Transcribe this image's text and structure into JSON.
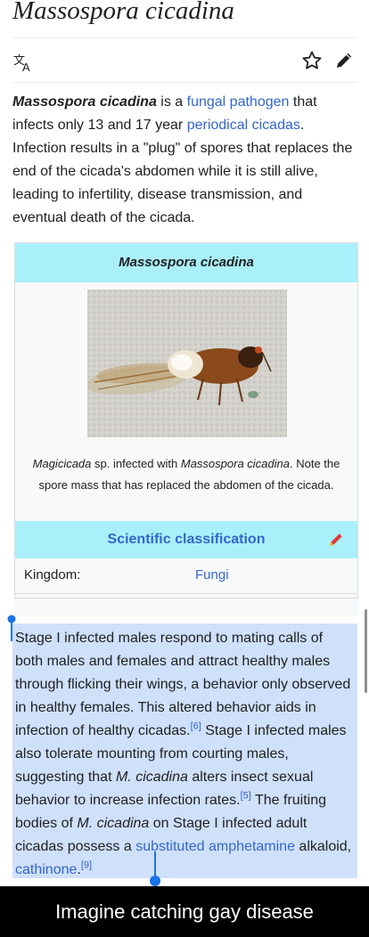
{
  "article": {
    "title": "Massospora cicadina",
    "intro": {
      "bold": "Massospora cicadina",
      "t1": " is a ",
      "link1": "fungal pathogen",
      "t2": " that infects only 13 and 17 year ",
      "link2": "periodical cicadas",
      "t3": ". Infection results in a \"plug\" of spores that replaces the end of the cicada's abdomen while it is still alive, leading to infertility, disease transmission, and eventual death of the cicada."
    }
  },
  "actions": {
    "translate_icon": "translate-icon",
    "watch_icon": "star-icon",
    "edit_icon": "pencil-icon"
  },
  "infobox": {
    "header": "Massospora cicadina",
    "caption": {
      "italic1": "Magicicada",
      "t1": " sp. infected with ",
      "italic2": "Massospora cicadina",
      "t2": ". Note the spore mass that has replaced the abdomen of the cicada."
    },
    "classification_header": "Scientific classification",
    "rows": [
      {
        "label": "Kingdom:",
        "value": "Fungi"
      }
    ]
  },
  "selection": {
    "t1": "Stage I infected males respond to mating calls of both males and females and attract healthy males through flicking their wings, a behavior only observed in healthy females. This altered behavior aids in infection of healthy cicadas.",
    "ref1": "[6]",
    "t2": " Stage I infected males also tolerate mounting from courting males, suggesting that ",
    "italic1": "M. cicadina",
    "t3": " alters insect sexual behavior to increase infection rates.",
    "ref2": "[5]",
    "t4": " The fruiting bodies of ",
    "italic2": "M. cicadina",
    "t5": " on Stage I infected adult cicadas possess a ",
    "link1": "substituted amphetamine",
    "t6": " alkaloid, ",
    "link2": "cathinone",
    "t7": ".",
    "ref3": "[9]"
  },
  "meme_caption": "Imagine catching gay disease",
  "colors": {
    "link": "#3366cc",
    "infobox_header": "#aaf0fa",
    "selection": "#cfe0fb",
    "handle": "#1a73e8"
  }
}
